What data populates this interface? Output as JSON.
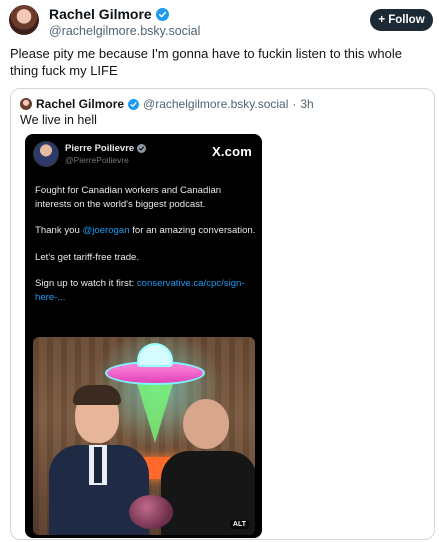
{
  "author": {
    "display_name": "Rachel Gilmore",
    "handle": "@rachelgilmore.bsky.social"
  },
  "follow_button": {
    "label": "+ Follow"
  },
  "post": {
    "text": "Please pity me because I'm gonna have to fuckin listen to this whole thing fuck my LIFE"
  },
  "quote": {
    "display_name": "Rachel Gilmore",
    "handle": "@rachelgilmore.bsky.social",
    "separator": "·",
    "time": "3h",
    "text": "We live in hell",
    "embed": {
      "name": "Pierre Poilievre",
      "handle": "@PierrePoilievre",
      "site": "X.com",
      "para1": "Fought for Canadian workers and Canadian interests on the world's biggest podcast.",
      "para2_prefix": "Thank you ",
      "para2_mention": "@joerogan",
      "para2_suffix": " for an amazing conversation.",
      "para3": "Let's get tariff-free trade.",
      "para4_prefix": "Sign up to watch it first: ",
      "para4_link": "conservative.ca/cpc/sign-here-...",
      "alt_badge": "ALT"
    }
  },
  "icons": {
    "verified": "verified-badge-icon",
    "plus": "plus-icon"
  },
  "colors": {
    "accent_blue": "#1d9bf0",
    "follow_bg": "#1d2a35"
  }
}
